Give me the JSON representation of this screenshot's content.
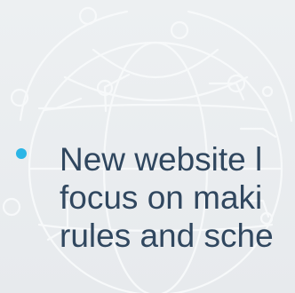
{
  "slide": {
    "bullet_text": {
      "line1": "New website l",
      "line2": "focus on maki",
      "line3": "rules and sche"
    },
    "colors": {
      "background": "#edf0f2",
      "text": "#30475f",
      "bullet": "#2bb5e6",
      "decorative_lines": "#f8fafb"
    },
    "icons": {
      "background": "globe-network-icon",
      "bullet": "bullet-dot-icon"
    }
  }
}
